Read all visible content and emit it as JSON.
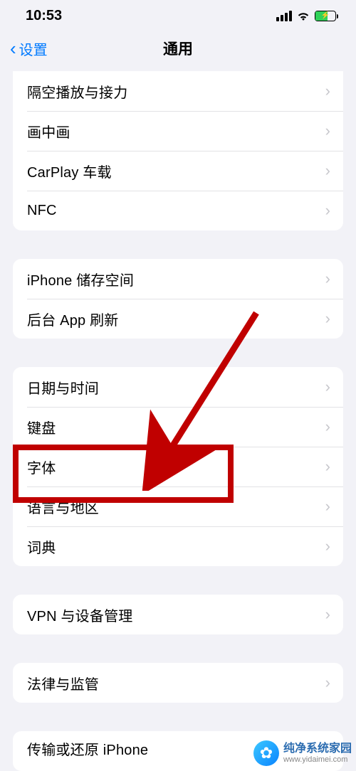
{
  "statusBar": {
    "time": "10:53"
  },
  "nav": {
    "back": "设置",
    "title": "通用"
  },
  "groups": [
    {
      "items": [
        {
          "key": "airplay",
          "label": "隔空播放与接力"
        },
        {
          "key": "pip",
          "label": "画中画"
        },
        {
          "key": "carplay",
          "label": "CarPlay 车载"
        },
        {
          "key": "nfc",
          "label": "NFC"
        }
      ]
    },
    {
      "items": [
        {
          "key": "storage",
          "label": "iPhone 储存空间"
        },
        {
          "key": "bgapp",
          "label": "后台 App 刷新"
        }
      ]
    },
    {
      "items": [
        {
          "key": "datetime",
          "label": "日期与时间"
        },
        {
          "key": "keyboard",
          "label": "键盘"
        },
        {
          "key": "fonts",
          "label": "字体"
        },
        {
          "key": "langregion",
          "label": "语言与地区"
        },
        {
          "key": "dict",
          "label": "词典"
        }
      ]
    },
    {
      "items": [
        {
          "key": "vpn",
          "label": "VPN 与设备管理"
        }
      ]
    },
    {
      "items": [
        {
          "key": "legal",
          "label": "法律与监管"
        }
      ]
    },
    {
      "items": [
        {
          "key": "transfer",
          "label": "传输或还原 iPhone"
        }
      ]
    }
  ],
  "watermark": {
    "title": "纯净系统家园",
    "url": "www.yidaimei.com"
  }
}
